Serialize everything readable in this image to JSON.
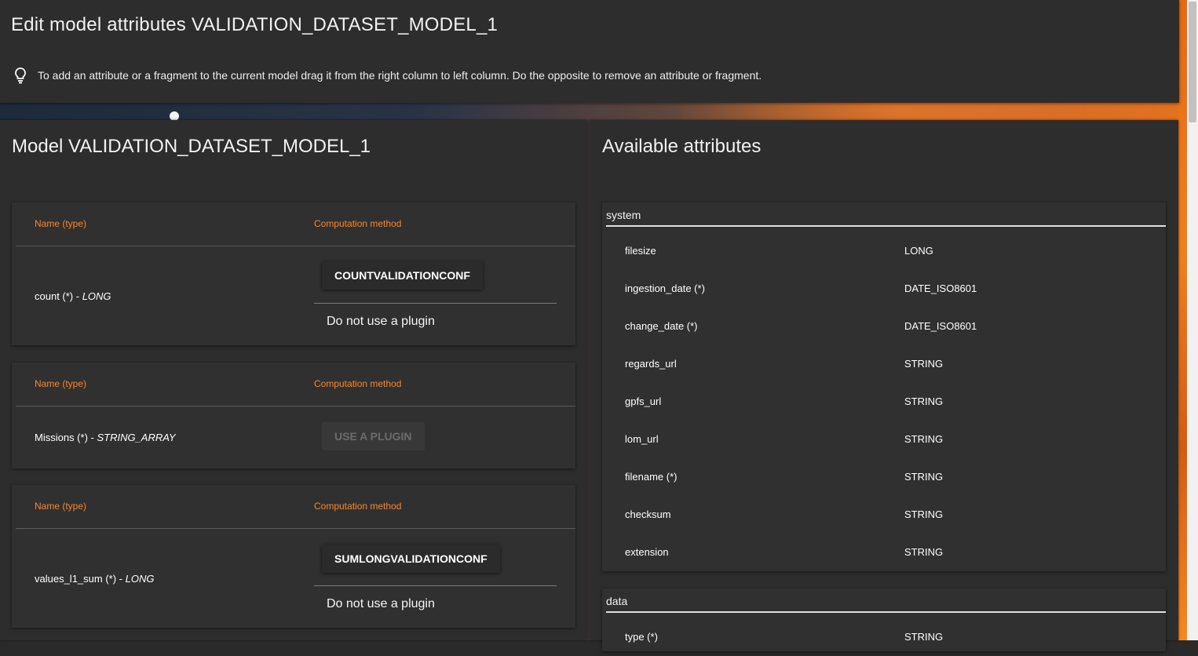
{
  "header": {
    "title": "Edit model attributes VALIDATION_DATASET_MODEL_1",
    "hint": "To add an attribute or a fragment to the current model drag it from the right column to left column. Do the opposite to remove an attribute or fragment."
  },
  "left": {
    "title": "Model VALIDATION_DATASET_MODEL_1",
    "col_name": "Name (type)",
    "col_comp": "Computation method",
    "rows": [
      {
        "name": "count (*) - ",
        "type": "LONG",
        "button": "COUNTVALIDATIONCONF",
        "no_plugin": "Do not use a plugin"
      },
      {
        "name": "Missions (*) - ",
        "type": "STRING_ARRAY",
        "button": "USE A PLUGIN"
      },
      {
        "name": "values_l1_sum (*) - ",
        "type": "LONG",
        "button": "SUMLONGVALIDATIONCONF",
        "no_plugin": "Do not use a plugin"
      }
    ]
  },
  "right": {
    "title": "Available attributes",
    "groups": [
      {
        "name": "system",
        "items": [
          {
            "name": "filesize",
            "type": "LONG"
          },
          {
            "name": "ingestion_date (*)",
            "type": "DATE_ISO8601"
          },
          {
            "name": "change_date (*)",
            "type": "DATE_ISO8601"
          },
          {
            "name": "regards_url",
            "type": "STRING"
          },
          {
            "name": "gpfs_url",
            "type": "STRING"
          },
          {
            "name": "lom_url",
            "type": "STRING"
          },
          {
            "name": "filename (*)",
            "type": "STRING"
          },
          {
            "name": "checksum",
            "type": "STRING"
          },
          {
            "name": "extension",
            "type": "STRING"
          }
        ]
      },
      {
        "name": "data",
        "items": [
          {
            "name": "type (*)",
            "type": "STRING"
          }
        ]
      }
    ]
  },
  "icons": {
    "hint": "lightbulb-icon"
  },
  "colors": {
    "accent": "#ff8426",
    "background": "#2d2d2d"
  }
}
